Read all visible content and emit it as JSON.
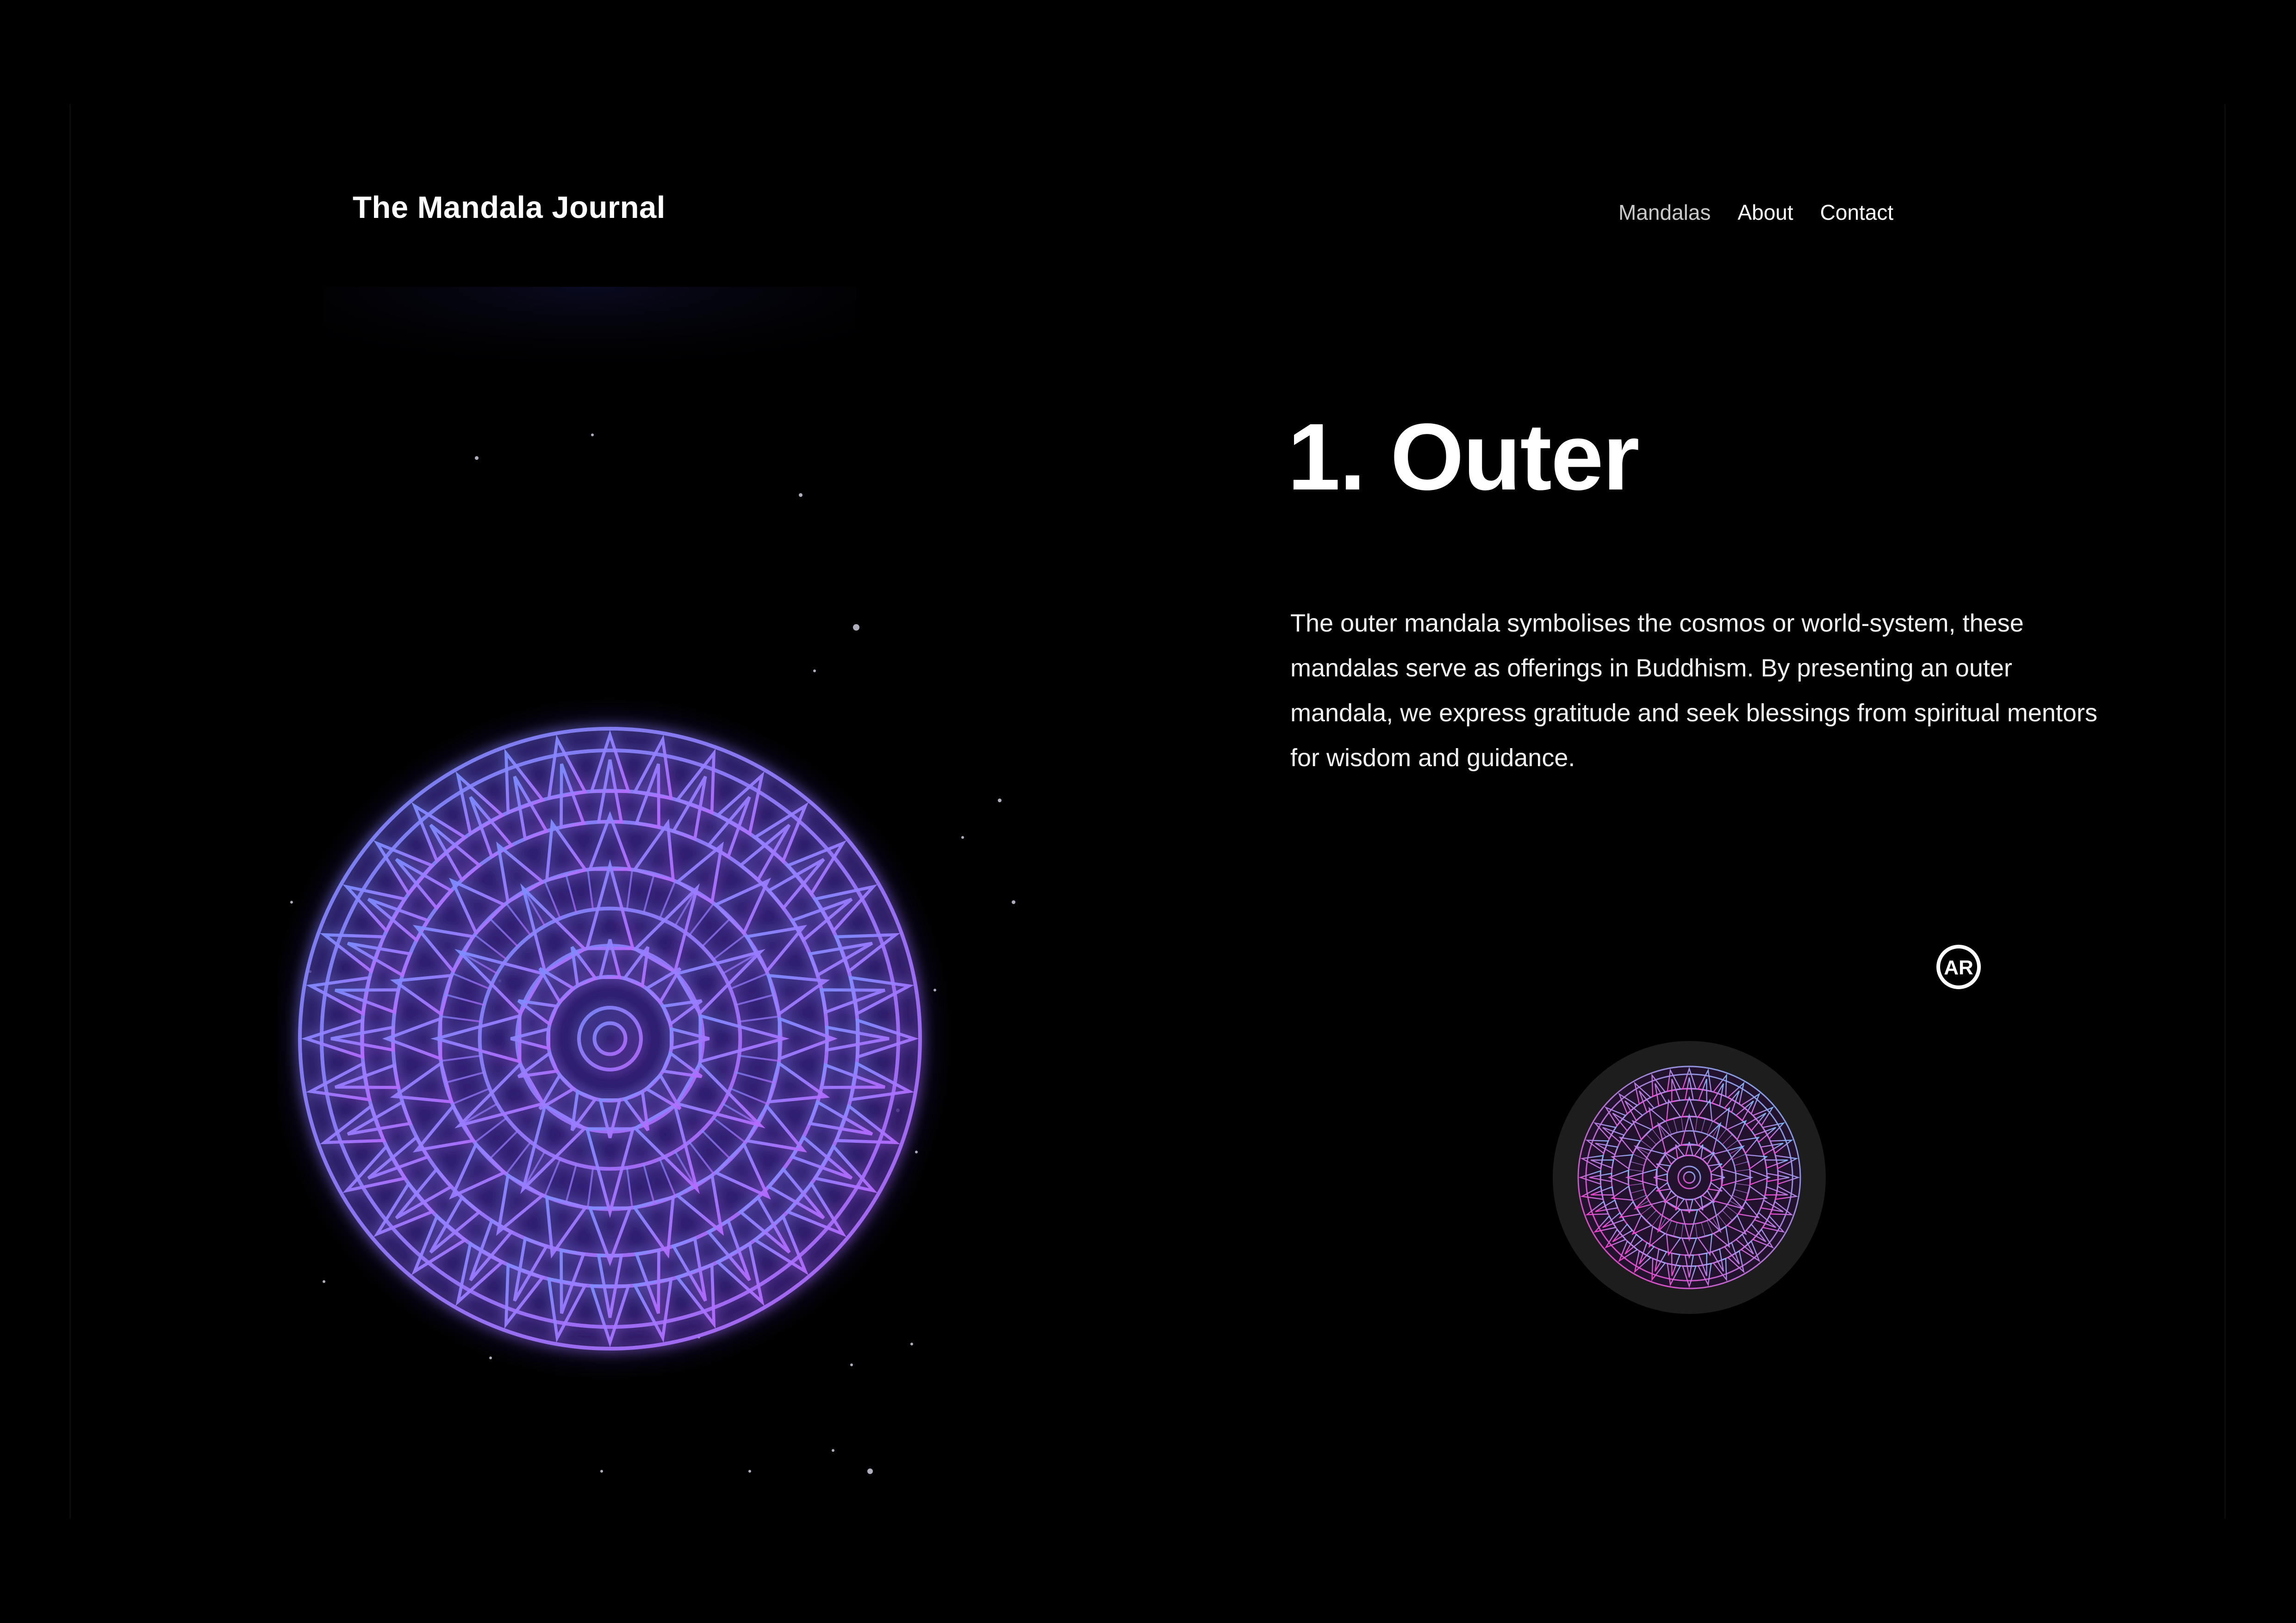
{
  "header": {
    "site_title": "The Mandala Journal",
    "nav": [
      {
        "label": "Mandalas",
        "active": false
      },
      {
        "label": "About",
        "active": true
      },
      {
        "label": "Contact",
        "active": true
      }
    ]
  },
  "main": {
    "heading": "1. Outer",
    "description": "The outer mandala symbolises the cosmos or world-system, these mandalas serve as offerings in Buddhism. By presenting an outer mandala, we express gratitude and seek blessings from spiritual mentors for wisdom and guidance."
  },
  "ar_badge": {
    "label": "AR",
    "icon": "ar-icon"
  },
  "colors": {
    "background": "#000000",
    "mandala_primary": "#9b6bff",
    "mandala_secondary": "#6f7cff",
    "thumb_primary": "#ff4fd8",
    "thumb_secondary": "#7fb6ff"
  }
}
